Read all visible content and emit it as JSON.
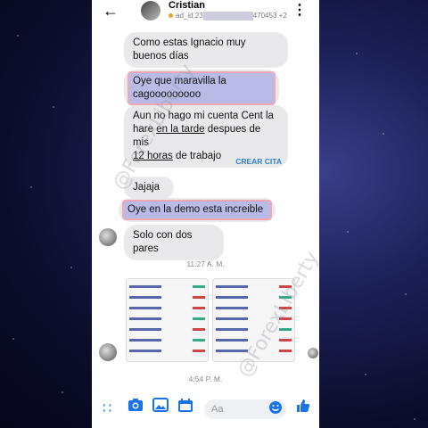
{
  "header": {
    "back_icon": "arrow-left-icon",
    "contact_name": "Cristian",
    "ad_id": "ad_id.23",
    "ad_id_suffix": "470453",
    "extra_count": "+2",
    "menu_icon": "more-vert-icon"
  },
  "messages": [
    {
      "text": "Como estas Ignacio muy buenos días"
    },
    {
      "text": "Oye que maravilla la cagooooooooo"
    },
    {
      "line1": "Aun no hago mi cuenta Cent la",
      "line2_pre": "hare ",
      "line2_link": "en la tarde",
      "line2_post": " despues de mis",
      "line3_link": "12 horas",
      "line3_post": " de trabajo"
    },
    {
      "text": "Jajaja"
    },
    {
      "text": "Oye en la demo esta increible"
    },
    {
      "text": "Solo con dos pares"
    }
  ],
  "cta": {
    "create_appointment": "CREAR CITA"
  },
  "times": {
    "t1": "11:27 A. M.",
    "t2": "4:54 P. M."
  },
  "composer": {
    "placeholder": "Aa"
  },
  "watermark": "@ForexLiberty",
  "colors": {
    "accent": "#1a73e8",
    "highlight": "#b7bbe6",
    "highlight_border": "#f3a6b4"
  }
}
